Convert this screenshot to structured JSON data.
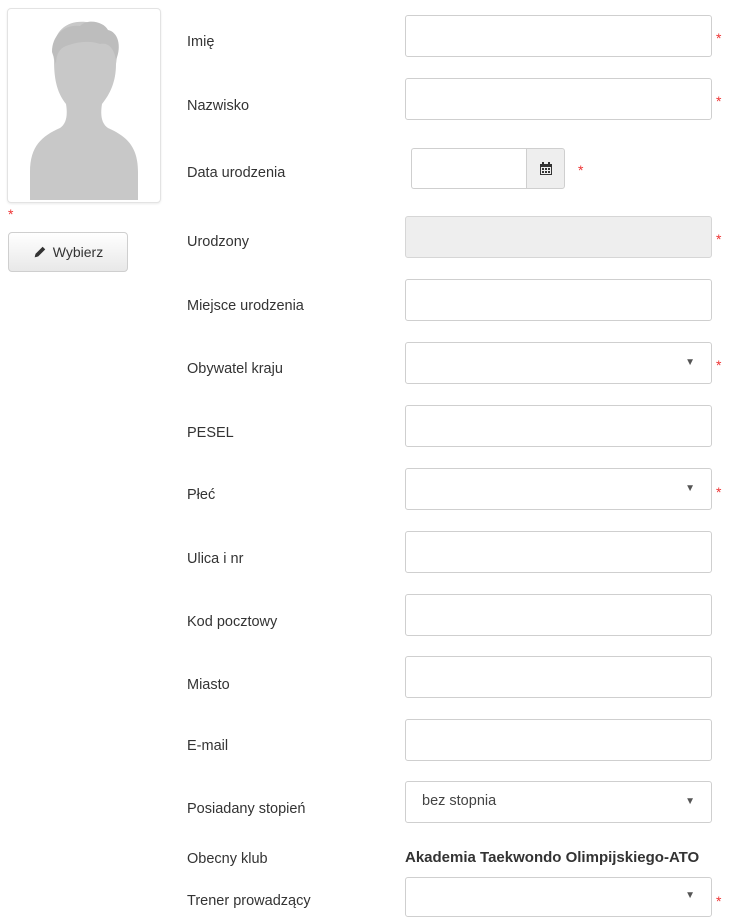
{
  "photo": {
    "required_mark": "*",
    "choose_label": "Wybierz",
    "choose_icon": "pencil-icon"
  },
  "form": {
    "fields": [
      {
        "label": "Imię",
        "type": "text",
        "value": "",
        "required": true
      },
      {
        "label": "Nazwisko",
        "type": "text",
        "value": "",
        "required": true
      },
      {
        "label": "Data urodzenia",
        "type": "date",
        "value": "",
        "required": true,
        "icon": "calendar-icon"
      },
      {
        "label": "Urodzony",
        "type": "text-disabled",
        "value": "",
        "required": true
      },
      {
        "label": "Miejsce urodzenia",
        "type": "text",
        "value": "",
        "required": false
      },
      {
        "label": "Obywatel kraju",
        "type": "select",
        "value": "",
        "required": true
      },
      {
        "label": "PESEL",
        "type": "text",
        "value": "",
        "required": false
      },
      {
        "label": "Płeć",
        "type": "select",
        "value": "",
        "required": true
      },
      {
        "label": "Ulica i nr",
        "type": "text",
        "value": "",
        "required": false
      },
      {
        "label": "Kod pocztowy",
        "type": "text",
        "value": "",
        "required": false
      },
      {
        "label": "Miasto",
        "type": "text",
        "value": "",
        "required": false
      },
      {
        "label": "E-mail",
        "type": "text",
        "value": "",
        "required": false
      },
      {
        "label": "Posiadany stopień",
        "type": "select",
        "value": "bez stopnia",
        "required": false
      },
      {
        "label": "Obecny klub",
        "type": "static",
        "value": "Akademia Taekwondo Olimpijskiego-ATO",
        "required": false
      },
      {
        "label": "Trener prowadzący",
        "type": "select",
        "value": "",
        "required": true
      }
    ],
    "required_mark": "*",
    "select_arrow": "▼"
  },
  "colors": {
    "required": "#ee3333",
    "disabled_bg": "#eeeeee",
    "border": "#cfcfcf"
  }
}
